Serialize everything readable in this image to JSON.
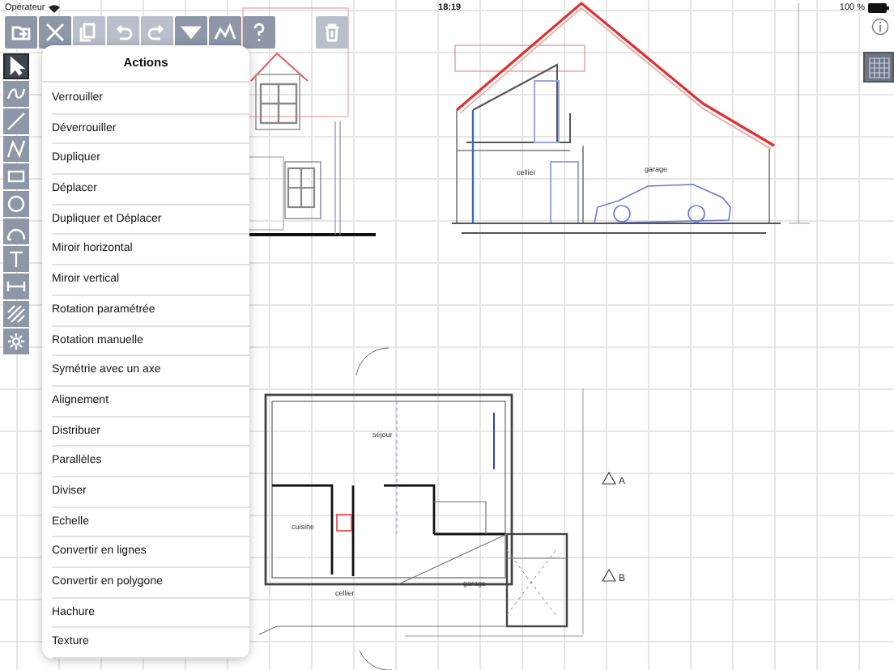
{
  "status_bar": {
    "carrier": "Opérateur",
    "time": "18:19",
    "battery": "100 %"
  },
  "toolbar": [
    {
      "kind": "open",
      "disabled": false
    },
    {
      "kind": "cut",
      "disabled": false
    },
    {
      "kind": "copy",
      "disabled": true
    },
    {
      "kind": "undo",
      "disabled": true
    },
    {
      "kind": "redo",
      "disabled": true
    },
    {
      "kind": "menu",
      "disabled": false
    },
    {
      "kind": "chart",
      "disabled": false
    },
    {
      "kind": "help",
      "disabled": false
    },
    {
      "kind": "trash",
      "disabled": true
    }
  ],
  "tools": [
    {
      "kind": "select",
      "selected": true
    },
    {
      "kind": "curve",
      "selected": false
    },
    {
      "kind": "line",
      "selected": false
    },
    {
      "kind": "zigzag",
      "selected": false
    },
    {
      "kind": "rect",
      "selected": false
    },
    {
      "kind": "circle",
      "selected": false
    },
    {
      "kind": "arc",
      "selected": false
    },
    {
      "kind": "text",
      "selected": false
    },
    {
      "kind": "dimension",
      "selected": false
    },
    {
      "kind": "hatch",
      "selected": false
    },
    {
      "kind": "gear",
      "selected": false
    }
  ],
  "popover": {
    "title": "Actions",
    "items": [
      "Verrouiller",
      "Déverrouiller",
      "Dupliquer",
      "Déplacer",
      "Dupliquer et Déplacer",
      "Miroir horizontal",
      "Miroir vertical",
      "Rotation paramétrée",
      "Rotation manuelle",
      "Symétrie avec un axe",
      "Alignement",
      "Distribuer",
      "Parallèles",
      "Diviser",
      "Echelle",
      "Convertir en lignes",
      "Convertir en polygone",
      "Hachure",
      "Texture"
    ]
  },
  "section": {
    "labels": [
      "cellier",
      "garage"
    ]
  },
  "plan": {
    "labels": [
      "séjour",
      "cuisine",
      "cellier",
      "garage"
    ],
    "markers": [
      "A",
      "B"
    ]
  }
}
